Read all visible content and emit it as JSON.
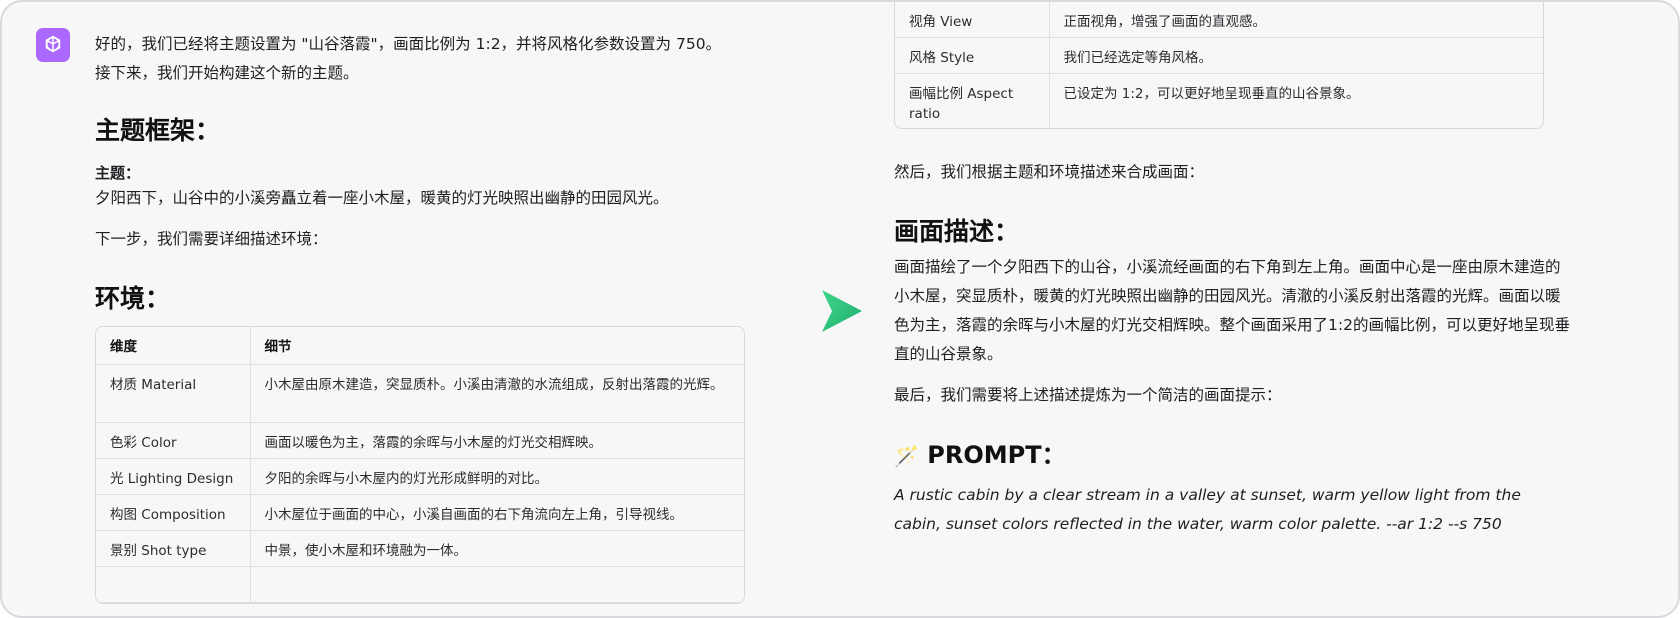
{
  "left": {
    "intro": [
      "好的，我们已经将主题设置为 \"山谷落霞\"，画面比例为 1:2，并将风格化参数设置为 750。",
      "接下来，我们开始构建这个新的主题。"
    ],
    "theme_heading": "主题框架：",
    "theme_label": "主题：",
    "theme_text": "夕阳西下，山谷中的小溪旁矗立着一座小木屋，暖黄的灯光映照出幽静的田园风光。",
    "next_step": "下一步，我们需要详细描述环境：",
    "env_heading": "环境：",
    "table": {
      "headers": [
        "维度",
        "细节"
      ],
      "rows": [
        [
          "材质 Material",
          "小木屋由原木建造，突显质朴。小溪由清澈的水流组成，反射出落霞的光辉。"
        ],
        [
          "色彩 Color",
          "画面以暖色为主，落霞的余晖与小木屋的灯光交相辉映。"
        ],
        [
          "光 Lighting Design",
          "夕阳的余晖与小木屋内的灯光形成鲜明的对比。"
        ],
        [
          "构图 Composition",
          "小木屋位于画面的中心，小溪自画面的右下角流向左上角，引导视线。"
        ],
        [
          "景别 Shot type",
          "中景，使小木屋和环境融为一体。"
        ],
        [
          "",
          ""
        ]
      ]
    }
  },
  "right": {
    "table": {
      "rows": [
        [
          "视角 View",
          "正面视角，增强了画面的直观感。"
        ],
        [
          "风格 Style",
          "我们已经选定等角风格。"
        ],
        [
          "画幅比例 Aspect ratio",
          "已设定为 1:2，可以更好地呈现垂直的山谷景象。"
        ]
      ]
    },
    "compose_intro": "然后，我们根据主题和环境描述来合成画面：",
    "desc_heading": "画面描述：",
    "desc_text": "画面描绘了一个夕阳西下的山谷，小溪流经画面的右下角到左上角。画面中心是一座由原木建造的小木屋，突显质朴，暖黄的灯光映照出幽静的田园风光。清澈的小溪反射出落霞的光辉。画面以暖色为主，落霞的余晖与小木屋的灯光交相辉映。整个画面采用了1:2的画幅比例，可以更好地呈现垂直的山谷景象。",
    "final_intro": "最后，我们需要将上述描述提炼为一个简洁的画面提示：",
    "prompt_icon": "🪄",
    "prompt_heading": "PROMPT：",
    "prompt_text": "A rustic cabin by a clear stream in a valley at sunset, warm yellow light from the cabin, sunset colors reflected in the water, warm color palette. --ar 1:2 --s 750"
  },
  "colors": {
    "avatar": "#ab68ff",
    "arrow": "#2fc57f",
    "background": "#f7f7f8"
  },
  "icons": {
    "avatar": "openai-logo-icon",
    "arrow": "arrow-right-icon",
    "prompt": "magic-wand-icon"
  }
}
